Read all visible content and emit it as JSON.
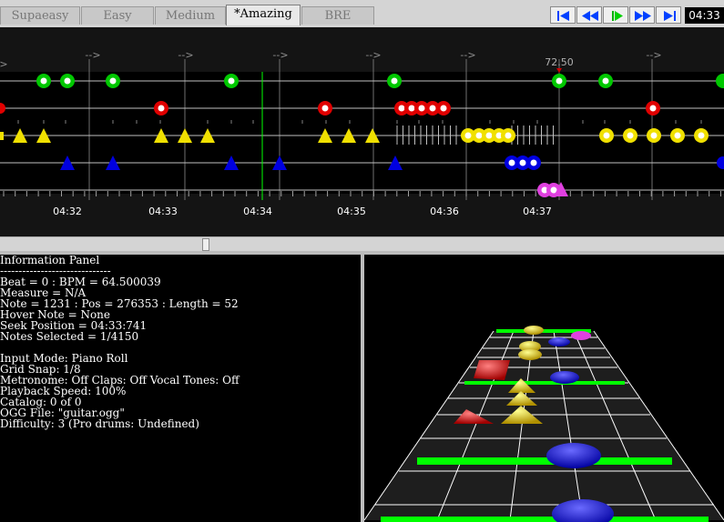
{
  "tabs": [
    {
      "label": "Supaeasy",
      "active": false
    },
    {
      "label": "Easy",
      "active": false
    },
    {
      "label": "Medium",
      "active": false
    },
    {
      "label": "*Amazing",
      "active": true
    },
    {
      "label": "BRE",
      "active": false
    }
  ],
  "transport": {
    "buttons": [
      "skip-to-start",
      "rewind",
      "play",
      "fast-forward",
      "skip-to-end"
    ],
    "time": "04:33"
  },
  "timeline": {
    "time_labels": [
      "04:32",
      "04:33",
      "04:34",
      "04:35",
      "04:36",
      "04:37"
    ],
    "bpm_label": "72.50",
    "tempo_marker": "-->",
    "tempo_marker_short": ">"
  },
  "colors": {
    "green": "#00c800",
    "red": "#e00000",
    "yellow": "#f0e000",
    "blue": "#0000e0",
    "pink": "#e040e0"
  },
  "info": {
    "lines": [
      "Information Panel",
      "------------------------------",
      "Beat = 0 : BPM = 64.500039",
      "Measure = N/A",
      "Note = 1231 : Pos = 276353 : Length = 52",
      "Hover Note = None",
      "Seek Position = 04:33:741",
      "Notes Selected = 1/4150",
      "",
      "Input Mode: Piano Roll",
      "Grid Snap: 1/8",
      "Metronome: Off Claps: Off Vocal Tones: Off",
      "Playback Speed: 100%",
      "Catalog: 0 of 0",
      "OGG File: \"guitar.ogg\"",
      "Difficulty: 3 (Pro drums: Undefined)"
    ]
  }
}
